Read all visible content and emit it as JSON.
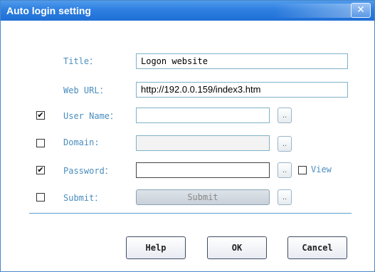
{
  "window": {
    "title": "Auto login setting",
    "close_glyph": "✕"
  },
  "form": {
    "title": {
      "label": "Title：",
      "value": "Logon website"
    },
    "web_url": {
      "label": "Web URL：",
      "value": "http://192.0.0.159/index3.htm"
    },
    "user_name": {
      "label": "User Name：",
      "value": "",
      "checked": true,
      "check_glyph": "✔"
    },
    "domain": {
      "label": "Domain:",
      "value": "",
      "checked": false,
      "check_glyph": ""
    },
    "password": {
      "label": "Password：",
      "value": "",
      "checked": true,
      "check_glyph": "✔"
    },
    "view": {
      "label": "View",
      "checked": false,
      "check_glyph": ""
    },
    "submit": {
      "label": "Submit：",
      "button_label": "Submit",
      "checked": false,
      "check_glyph": ""
    },
    "browse_label": ".."
  },
  "buttons": {
    "help": "Help",
    "ok": "OK",
    "cancel": "Cancel"
  }
}
